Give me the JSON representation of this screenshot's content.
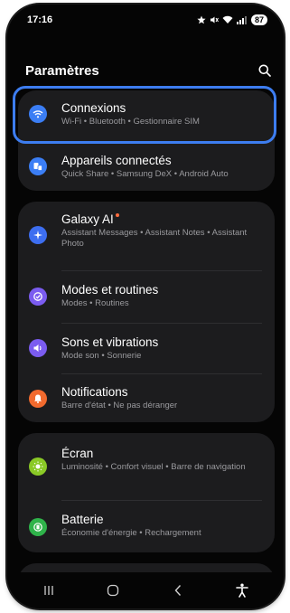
{
  "status_bar": {
    "time": "17:16",
    "icons": [
      "star-icon",
      "mute-icon",
      "wifi-icon",
      "signal-icon"
    ],
    "battery": "87"
  },
  "header": {
    "title": "Paramètres",
    "search_icon": "search-icon"
  },
  "groups": [
    {
      "items": [
        {
          "title": "Connexions",
          "subtitle": "Wi-Fi • Bluetooth • Gestionnaire SIM",
          "icon": "wifi-icon",
          "icon_color": "#3b7ef5",
          "selected": true
        },
        {
          "title": "Appareils connectés",
          "subtitle": "Quick Share • Samsung DeX • Android Auto",
          "icon": "connected-devices-icon",
          "icon_color": "#3b7ef5"
        }
      ]
    },
    {
      "items": [
        {
          "title": "Galaxy AI",
          "subtitle": "Assistant Messages • Assistant Notes • Assistant Photo",
          "icon": "galaxy-ai-icon",
          "icon_color": "#3d6ef0",
          "new_badge": true
        },
        {
          "title": "Modes et routines",
          "subtitle": "Modes • Routines",
          "icon": "modes-icon",
          "icon_color": "#7b5cf0"
        },
        {
          "title": "Sons et vibrations",
          "subtitle": "Mode son • Sonnerie",
          "icon": "sound-icon",
          "icon_color": "#7b5cf0"
        },
        {
          "title": "Notifications",
          "subtitle": "Barre d'état • Ne pas déranger",
          "icon": "bell-icon",
          "icon_color": "#f26a2e"
        }
      ]
    },
    {
      "items": [
        {
          "title": "Écran",
          "subtitle": "Luminosité • Confort visuel • Barre de navigation",
          "icon": "brightness-icon",
          "icon_color": "#8ac926"
        },
        {
          "title": "Batterie",
          "subtitle": "Économie d'énergie • Rechargement",
          "icon": "battery-icon",
          "icon_color": "#2fb34a"
        }
      ]
    }
  ],
  "nav_bar": {
    "icons": [
      "recents-icon",
      "home-icon",
      "back-icon",
      "accessibility-icon"
    ]
  },
  "colors": {
    "background": "#050505",
    "card": "#1c1c1e",
    "highlight": "#3d7df0",
    "subtitle": "#9a9a9e"
  }
}
